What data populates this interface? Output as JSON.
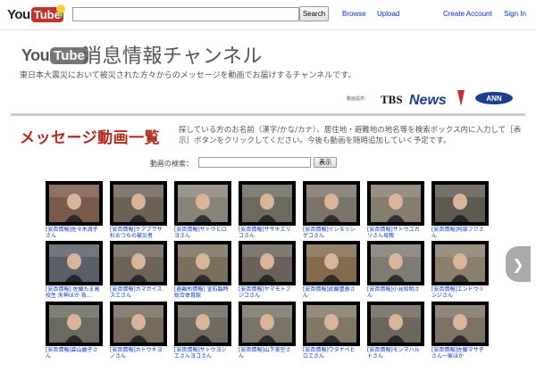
{
  "topbar": {
    "logo_you": "You",
    "logo_tube": "Tube",
    "search_button": "Search",
    "browse": "Browse",
    "upload": "Upload",
    "create_account": "Create Account",
    "sign_in": "Sign In"
  },
  "header": {
    "logo_you": "You",
    "logo_tube": "Tube",
    "title": "消息情報チャンネル",
    "subtitle": "東日本大震災において被災された方々からのメッセージを動画でお届けするチャンネルです。",
    "provided_by": "動画提供：",
    "tbs_news": "TBS News",
    "ann": "ANN"
  },
  "messages": {
    "heading": "メッセージ動画一覧",
    "description": "探している方のお名前（漢字/かな/カナ）、居住地・避難地の地名等を検索ボックス内に入力して［表示］ボタンをクリックしてください。今後も動画を随時追加していく予定です。",
    "search_label": "動画の検索：",
    "search_button": "表示",
    "next_icon": "chevron-right-icon"
  },
  "videos": [
    {
      "caption": "[安否情報]佐々木満子さん",
      "bg": "#7a5a4a"
    },
    {
      "caption": "[安否情報]ケアプラザ杉おつちの被災者",
      "bg": "#6b6256"
    },
    {
      "caption": "[安否情報]サトウヒロヨさん",
      "bg": "#8a8478"
    },
    {
      "caption": "[安否情報]ササキエリコさん",
      "bg": "#6c6a5e"
    },
    {
      "caption": "[安否情報]イシモリシゲコさん",
      "bg": "#7c7468"
    },
    {
      "caption": "[安否情報]サトウユカリさん母親",
      "bg": "#857d6d"
    },
    {
      "caption": "[安否情報]阿部フクさん",
      "bg": "#5e5a50"
    },
    {
      "caption": "[安否情報] 佐藤たま高校生 天神ほか 各…",
      "bg": "#5a5f68"
    },
    {
      "caption": "[安否情報]カマガイススエさん",
      "bg": "#6d6357"
    },
    {
      "caption": "[避難所情報] 釜石臨時総合体育館",
      "bg": "#7b6f5d"
    },
    {
      "caption": "[安否情報]ヤマモトフジコさん",
      "bg": "#6a625a"
    },
    {
      "caption": "[安否情報]武藤豊恵さん",
      "bg": "#836b4c"
    },
    {
      "caption": "[安否情報]小見和明さん",
      "bg": "#7f7a72"
    },
    {
      "caption": "[安否情報]エンドウリンジさん",
      "bg": "#8a7f6b"
    },
    {
      "caption": "[安否情報]森山麗子さん",
      "bg": "#6b6a60"
    },
    {
      "caption": "[安否情報]カトウキヨノさん",
      "bg": "#75695c"
    },
    {
      "caption": "[安否情報]サトウヨシエさんヨコさん",
      "bg": "#6f6a60"
    },
    {
      "caption": "[安否情報]山下美空さん",
      "bg": "#7a7468"
    },
    {
      "caption": "[安否情報]ワタナベヒロエさん",
      "bg": "#807764"
    },
    {
      "caption": "[安否情報]モンマハルトさん",
      "bg": "#6c665c"
    },
    {
      "caption": "[安否情報]佐藤マサ子さん一家ほか",
      "bg": "#7d7266"
    }
  ]
}
